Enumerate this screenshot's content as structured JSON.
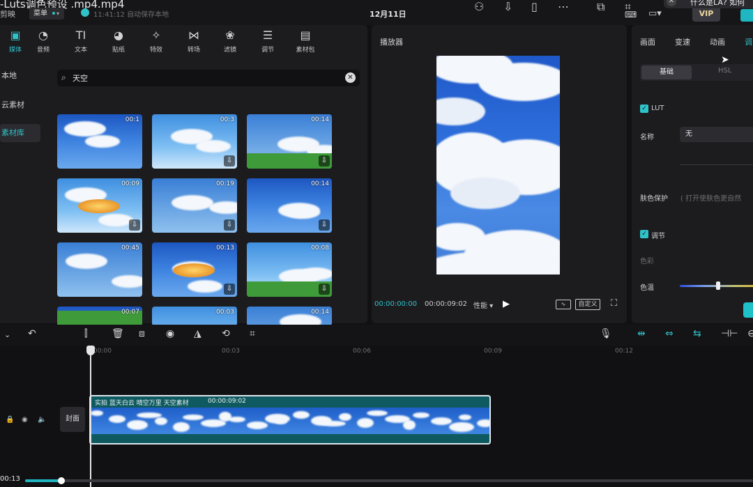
{
  "window": {
    "title": "-Luts调色预设 .mp4.mp4",
    "subtitle": "剪映",
    "menu_label": "菜单",
    "saved_status": "11:41:12 自动保存本地",
    "date": "12月11日",
    "vip_label": "VIP",
    "popup_text": "什么是LA? 如何"
  },
  "media": {
    "tabs": [
      {
        "label": "媒体",
        "icon": "media-icon"
      },
      {
        "label": "音频",
        "icon": "audio-icon"
      },
      {
        "label": "文本",
        "icon": "text-icon",
        "glyph": "TI"
      },
      {
        "label": "贴纸",
        "icon": "sticker-icon"
      },
      {
        "label": "特效",
        "icon": "effects-icon"
      },
      {
        "label": "转场",
        "icon": "transition-icon"
      },
      {
        "label": "滤镜",
        "icon": "filter-icon"
      },
      {
        "label": "调节",
        "icon": "adjust-icon"
      },
      {
        "label": "素材包",
        "icon": "package-icon"
      }
    ],
    "side_nav": [
      "本地",
      "云素材",
      "素材库"
    ],
    "search_value": "天空",
    "thumbnails": [
      {
        "duration": "00:1"
      },
      {
        "duration": "00:3"
      },
      {
        "duration": "00:14"
      },
      {
        "duration": "00:09"
      },
      {
        "duration": "00:19"
      },
      {
        "duration": "00:14"
      },
      {
        "duration": "00:45"
      },
      {
        "duration": "00:13"
      },
      {
        "duration": "00:08"
      },
      {
        "duration": "00:07"
      },
      {
        "duration": "00:03"
      },
      {
        "duration": "00:14"
      }
    ]
  },
  "player": {
    "title": "播放器",
    "current_time": "00:00:00:00",
    "total_time": "00:00:09:02",
    "performance_label": "性能",
    "custom_label": "自定义"
  },
  "inspector": {
    "tabs": [
      "画面",
      "变速",
      "动画",
      "调"
    ],
    "segments": [
      "基础",
      "HSL"
    ],
    "lut_label": "LUT",
    "name_label": "名称",
    "name_value": "无",
    "skin_label": "肤色保护",
    "skin_hint": "( 打开使肤色更自然",
    "adjust_label": "调节",
    "color_label": "色彩",
    "temp_label": "色温",
    "temp_value": 0.48
  },
  "timeline": {
    "ruler": [
      "00:00",
      "00:03",
      "00:06",
      "00:09",
      "00:12"
    ],
    "cover_label": "封面",
    "clip_label": "实拍 蓝天白云 晴空万里 天空素材",
    "clip_duration": "00:00:09:02",
    "current": "00:13",
    "progress": 0.05
  },
  "colors": {
    "accent": "#2fc2c8",
    "panel": "#1c1c1f",
    "background": "#111113"
  }
}
